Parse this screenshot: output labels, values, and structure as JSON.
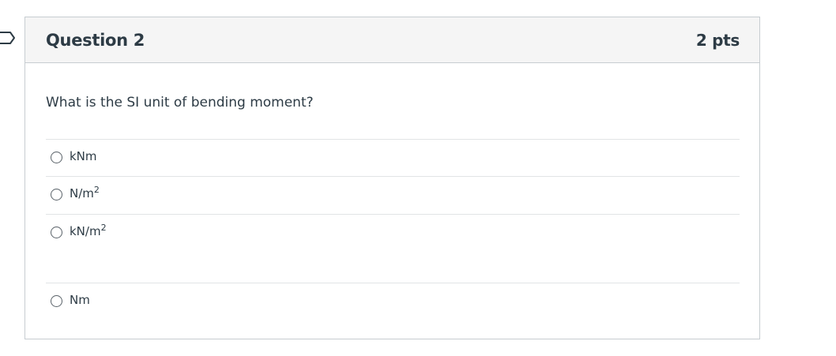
{
  "question": {
    "title": "Question 2",
    "points": "2 pts",
    "text": "What is the SI unit of bending moment?"
  },
  "answers": [
    {
      "base": "kNm",
      "sup": ""
    },
    {
      "base": "N/m",
      "sup": "2"
    },
    {
      "base": "kN/m",
      "sup": "2"
    },
    {
      "base": "Nm",
      "sup": ""
    }
  ],
  "colors": {
    "header_bg": "#f5f5f5",
    "border": "#c7cdd1",
    "text": "#2d3b45",
    "flag": "#2d3b45"
  },
  "icons": {
    "flag": "bookmark-flag-icon",
    "radio": "radio-unchecked"
  }
}
